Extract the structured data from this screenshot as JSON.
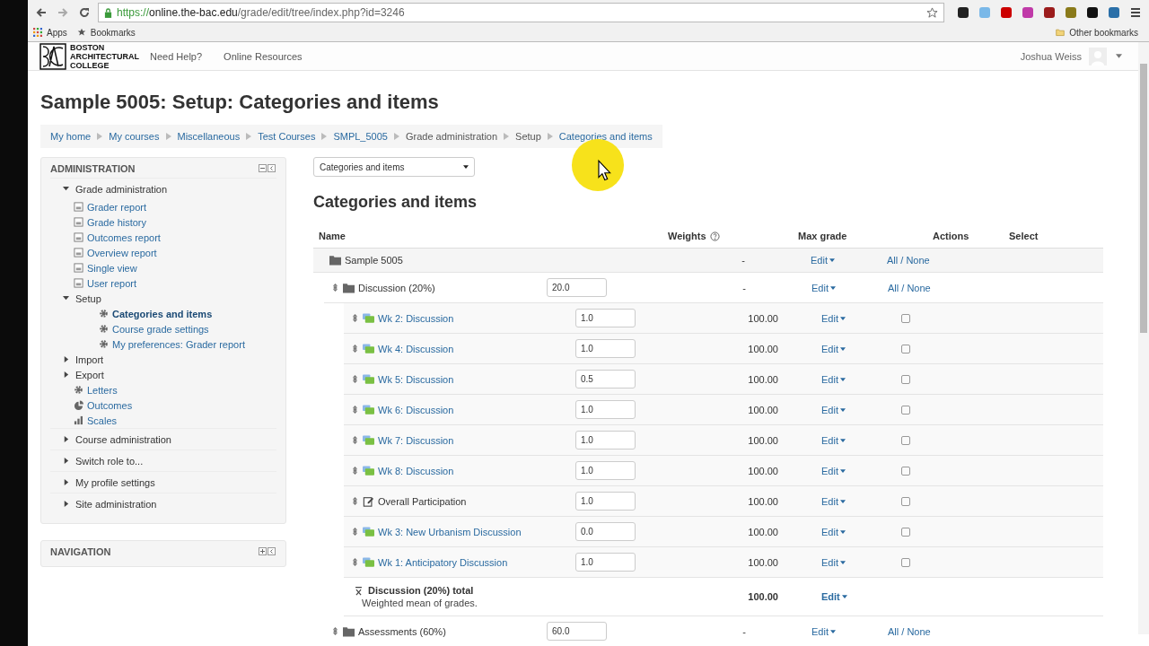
{
  "browser": {
    "url_secure": "https://",
    "url_host": "online.the-bac.edu",
    "url_path": "/grade/edit/tree/index.php?id=3246",
    "bookmarks": [
      "Apps",
      "Bookmarks"
    ],
    "other_bookmarks": "Other bookmarks"
  },
  "header": {
    "logo_lines": [
      "BOSTON",
      "ARCHITECTURAL",
      "COLLEGE"
    ],
    "links": [
      "Need Help?",
      "Online Resources"
    ],
    "user": "Joshua Weiss"
  },
  "page_title": "Sample 5005: Setup: Categories and items",
  "breadcrumbs": [
    {
      "label": "My home",
      "link": true
    },
    {
      "label": "My courses",
      "link": true
    },
    {
      "label": "Miscellaneous",
      "link": true
    },
    {
      "label": "Test Courses",
      "link": true
    },
    {
      "label": "SMPL_5005",
      "link": true
    },
    {
      "label": "Grade administration",
      "link": false
    },
    {
      "label": "Setup",
      "link": false
    },
    {
      "label": "Categories and items",
      "link": true
    }
  ],
  "administration": {
    "title": "ADMINISTRATION",
    "items": [
      {
        "label": "Grade administration",
        "kind": "branch",
        "expanded": true,
        "children": [
          {
            "label": "Grader report",
            "kind": "report"
          },
          {
            "label": "Grade history",
            "kind": "report"
          },
          {
            "label": "Outcomes report",
            "kind": "report"
          },
          {
            "label": "Overview report",
            "kind": "report"
          },
          {
            "label": "Single view",
            "kind": "report"
          },
          {
            "label": "User report",
            "kind": "report"
          },
          {
            "label": "Setup",
            "kind": "branch",
            "expanded": true,
            "children": [
              {
                "label": "Categories and items",
                "kind": "gear",
                "selected": true
              },
              {
                "label": "Course grade settings",
                "kind": "gear",
                "selected": false
              },
              {
                "label": "My preferences: Grader report",
                "kind": "gear",
                "selected": false
              }
            ]
          },
          {
            "label": "Import",
            "kind": "branch",
            "expanded": false
          },
          {
            "label": "Export",
            "kind": "branch",
            "expanded": false
          },
          {
            "label": "Letters",
            "kind": "gear"
          },
          {
            "label": "Outcomes",
            "kind": "outcomes"
          },
          {
            "label": "Scales",
            "kind": "scales"
          }
        ]
      },
      {
        "label": "Course administration",
        "kind": "branch",
        "expanded": false
      },
      {
        "label": "Switch role to...",
        "kind": "branch",
        "expanded": false
      },
      {
        "label": "My profile settings",
        "kind": "branch",
        "expanded": false
      },
      {
        "label": "Site administration",
        "kind": "branch",
        "expanded": false
      }
    ]
  },
  "navigation": {
    "title": "NAVIGATION"
  },
  "view_select": {
    "value": "Categories and items"
  },
  "heading": "Categories and items",
  "table": {
    "columns": [
      "Name",
      "Weights",
      "Max grade",
      "Actions",
      "Select"
    ],
    "rows": [
      {
        "kind": "category",
        "name": "Sample 5005",
        "max_grade": "-",
        "action": "Edit",
        "select": "All / None",
        "children": [
          {
            "kind": "category",
            "name": "Discussion (20%)",
            "weight": "20.0",
            "max_grade": "-",
            "action": "Edit",
            "select": "All / None",
            "children": [
              {
                "kind": "forum",
                "name": "Wk 2: Discussion",
                "weight": "1.0",
                "max_grade": "100.00",
                "action": "Edit",
                "checked": false
              },
              {
                "kind": "forum",
                "name": "Wk 4: Discussion",
                "weight": "1.0",
                "max_grade": "100.00",
                "action": "Edit",
                "checked": false
              },
              {
                "kind": "forum",
                "name": "Wk 5: Discussion",
                "weight": "0.5",
                "max_grade": "100.00",
                "action": "Edit",
                "checked": false
              },
              {
                "kind": "forum",
                "name": "Wk 6: Discussion",
                "weight": "1.0",
                "max_grade": "100.00",
                "action": "Edit",
                "checked": false
              },
              {
                "kind": "forum",
                "name": "Wk 7: Discussion",
                "weight": "1.0",
                "max_grade": "100.00",
                "action": "Edit",
                "checked": false
              },
              {
                "kind": "forum",
                "name": "Wk 8: Discussion",
                "weight": "1.0",
                "max_grade": "100.00",
                "action": "Edit",
                "checked": false
              },
              {
                "kind": "assignment",
                "name": "Overall Participation",
                "weight": "1.0",
                "max_grade": "100.00",
                "action": "Edit",
                "checked": false
              },
              {
                "kind": "forum",
                "name": "Wk 3: New Urbanism Discussion",
                "weight": "0.0",
                "max_grade": "100.00",
                "action": "Edit",
                "checked": false
              },
              {
                "kind": "forum",
                "name": "Wk 1: Anticipatory Discussion",
                "weight": "1.0",
                "max_grade": "100.00",
                "action": "Edit",
                "checked": false
              },
              {
                "kind": "total",
                "name": "Discussion (20%) total",
                "note": "Weighted mean of grades.",
                "max_grade": "100.00",
                "action": "Edit"
              }
            ]
          },
          {
            "kind": "category",
            "name": "Assessments (60%)",
            "weight": "60.0",
            "max_grade": "-",
            "action": "Edit",
            "select": "All / None"
          }
        ]
      }
    ]
  }
}
